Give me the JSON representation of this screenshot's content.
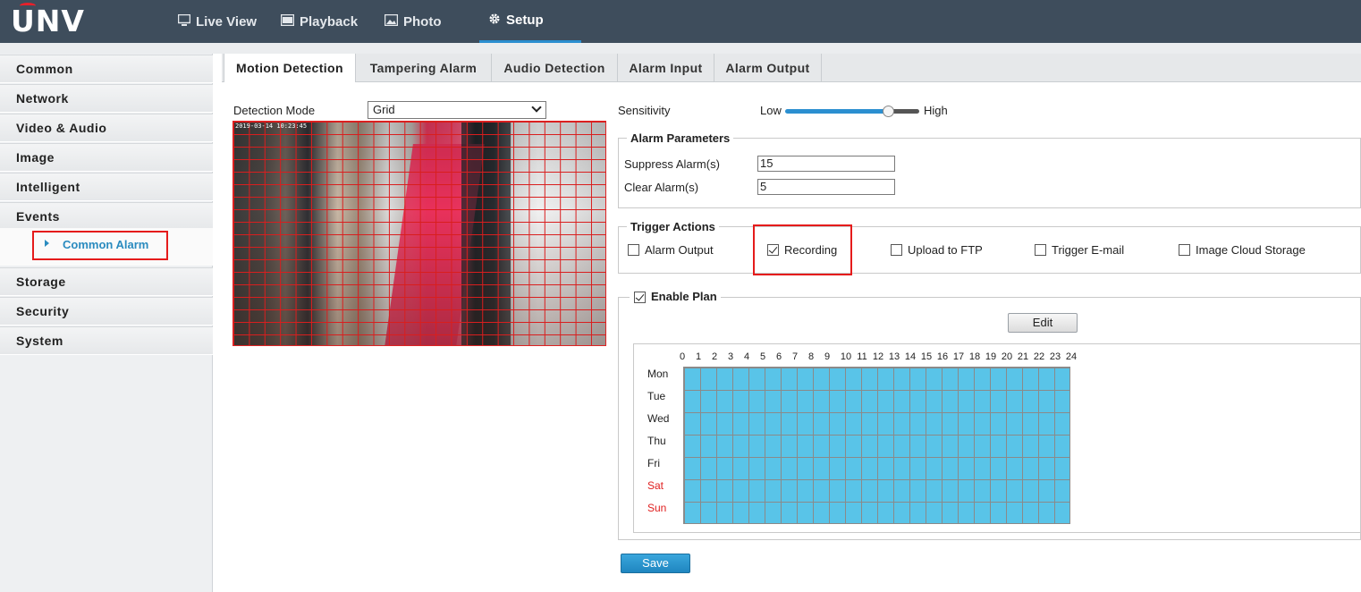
{
  "header": {
    "logo": "UNV",
    "nav": [
      {
        "label": "Live View",
        "icon": "monitor-icon"
      },
      {
        "label": "Playback",
        "icon": "film-icon"
      },
      {
        "label": "Photo",
        "icon": "image-icon"
      },
      {
        "label": "Setup",
        "icon": "gear-icon",
        "active": true
      }
    ]
  },
  "sidebar": {
    "items": [
      "Common",
      "Network",
      "Video & Audio",
      "Image",
      "Intelligent",
      "Events",
      "Storage",
      "Security",
      "System"
    ],
    "sub_item": "Common Alarm"
  },
  "tabs": [
    "Motion Detection",
    "Tampering Alarm",
    "Audio Detection",
    "Alarm Input",
    "Alarm Output"
  ],
  "detection": {
    "mode_label": "Detection Mode",
    "mode_value": "Grid",
    "video_timestamp": "2019-03-14 10:23:45"
  },
  "sensitivity": {
    "label": "Sensitivity",
    "low": "Low",
    "high": "High",
    "level": 0.77
  },
  "alarm_parameters": {
    "legend": "Alarm Parameters",
    "suppress_label": "Suppress Alarm(s)",
    "suppress_value": "15",
    "clear_label": "Clear Alarm(s)",
    "clear_value": "5"
  },
  "trigger_actions": {
    "legend": "Trigger Actions",
    "options": [
      {
        "label": "Alarm Output",
        "checked": false
      },
      {
        "label": "Recording",
        "checked": true
      },
      {
        "label": "Upload to FTP",
        "checked": false
      },
      {
        "label": "Trigger E-mail",
        "checked": false
      },
      {
        "label": "Image Cloud Storage",
        "checked": false
      }
    ]
  },
  "plan": {
    "legend": "Enable Plan",
    "enabled": true,
    "edit_label": "Edit",
    "hours": [
      "0",
      "1",
      "2",
      "3",
      "4",
      "5",
      "6",
      "7",
      "8",
      "9",
      "10",
      "11",
      "12",
      "13",
      "14",
      "15",
      "16",
      "17",
      "18",
      "19",
      "20",
      "21",
      "22",
      "23",
      "24"
    ],
    "days": [
      "Mon",
      "Tue",
      "Wed",
      "Thu",
      "Fri",
      "Sat",
      "Sun"
    ],
    "schedule_color": "#59c4e8",
    "weekend_color": "#e02020"
  },
  "save_label": "Save"
}
